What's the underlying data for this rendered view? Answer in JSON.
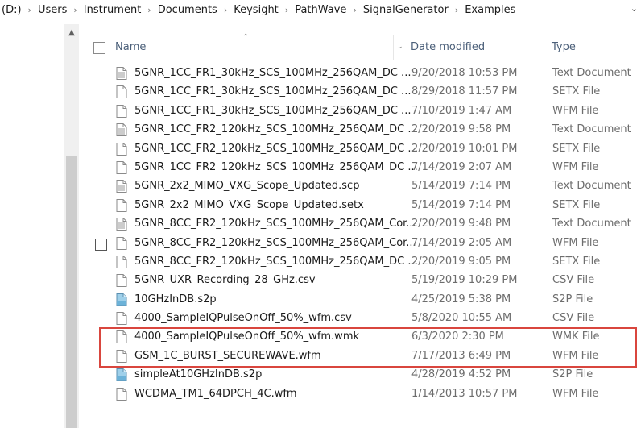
{
  "breadcrumb": [
    "(D:)",
    "Users",
    "Instrument",
    "Documents",
    "Keysight",
    "PathWave",
    "SignalGenerator",
    "Examples"
  ],
  "columns": {
    "name": "Name",
    "date": "Date modified",
    "type": "Type"
  },
  "files": [
    {
      "name": "5GNR_1CC_FR1_30kHz_SCS_100MHz_256QAM_DC ...",
      "date": "9/20/2018 10:53 PM",
      "type": "Text Document",
      "icon": "text-file-icon"
    },
    {
      "name": "5GNR_1CC_FR1_30kHz_SCS_100MHz_256QAM_DC ...",
      "date": "8/29/2018 11:57 PM",
      "type": "SETX File",
      "icon": "file-icon"
    },
    {
      "name": "5GNR_1CC_FR1_30kHz_SCS_100MHz_256QAM_DC ...",
      "date": "7/10/2019 1:47 AM",
      "type": "WFM File",
      "icon": "file-icon"
    },
    {
      "name": "5GNR_1CC_FR2_120kHz_SCS_100MHz_256QAM_DC ...",
      "date": "2/20/2019 9:58 PM",
      "type": "Text Document",
      "icon": "text-file-icon"
    },
    {
      "name": "5GNR_1CC_FR2_120kHz_SCS_100MHz_256QAM_DC ...",
      "date": "2/20/2019 10:01 PM",
      "type": "SETX File",
      "icon": "file-icon"
    },
    {
      "name": "5GNR_1CC_FR2_120kHz_SCS_100MHz_256QAM_DC ...",
      "date": "7/14/2019 2:07 AM",
      "type": "WFM File",
      "icon": "file-icon"
    },
    {
      "name": "5GNR_2x2_MIMO_VXG_Scope_Updated.scp",
      "date": "5/14/2019 7:14 PM",
      "type": "Text Document",
      "icon": "text-file-icon"
    },
    {
      "name": "5GNR_2x2_MIMO_VXG_Scope_Updated.setx",
      "date": "5/14/2019 7:14 PM",
      "type": "SETX File",
      "icon": "file-icon"
    },
    {
      "name": "5GNR_8CC_FR2_120kHz_SCS_100MHz_256QAM_Cor...",
      "date": "2/20/2019 9:48 PM",
      "type": "Text Document",
      "icon": "text-file-icon"
    },
    {
      "name": "5GNR_8CC_FR2_120kHz_SCS_100MHz_256QAM_Cor...",
      "date": "7/14/2019 2:05 AM",
      "type": "WFM File",
      "icon": "file-icon",
      "checkbox": true
    },
    {
      "name": "5GNR_8CC_FR2_120kHz_SCS_100MHz_256QAM_DC ...",
      "date": "2/20/2019 9:05 PM",
      "type": "SETX File",
      "icon": "file-icon"
    },
    {
      "name": "5GNR_UXR_Recording_28_GHz.csv",
      "date": "5/19/2019 10:29 PM",
      "type": "CSV File",
      "icon": "file-icon"
    },
    {
      "name": "10GHzInDB.s2p",
      "date": "4/25/2019 5:38 PM",
      "type": "S2P File",
      "icon": "s2p-file-icon"
    },
    {
      "name": "4000_SampleIQPulseOnOff_50%_wfm.csv",
      "date": "5/8/2020 10:55 AM",
      "type": "CSV File",
      "icon": "file-icon"
    },
    {
      "name": "4000_SampleIQPulseOnOff_50%_wfm.wmk",
      "date": "6/3/2020 2:30 PM",
      "type": "WMK File",
      "icon": "file-icon"
    },
    {
      "name": "GSM_1C_BURST_SECUREWAVE.wfm",
      "date": "7/17/2013 6:49 PM",
      "type": "WFM File",
      "icon": "file-icon"
    },
    {
      "name": "simpleAt10GHzInDB.s2p",
      "date": "4/28/2019 4:52 PM",
      "type": "S2P File",
      "icon": "s2p-file-icon"
    },
    {
      "name": "WCDMA_TM1_64DPCH_4C.wfm",
      "date": "1/14/2013 10:57 PM",
      "type": "WFM File",
      "icon": "file-icon"
    }
  ],
  "highlight_color": "#d9463e"
}
